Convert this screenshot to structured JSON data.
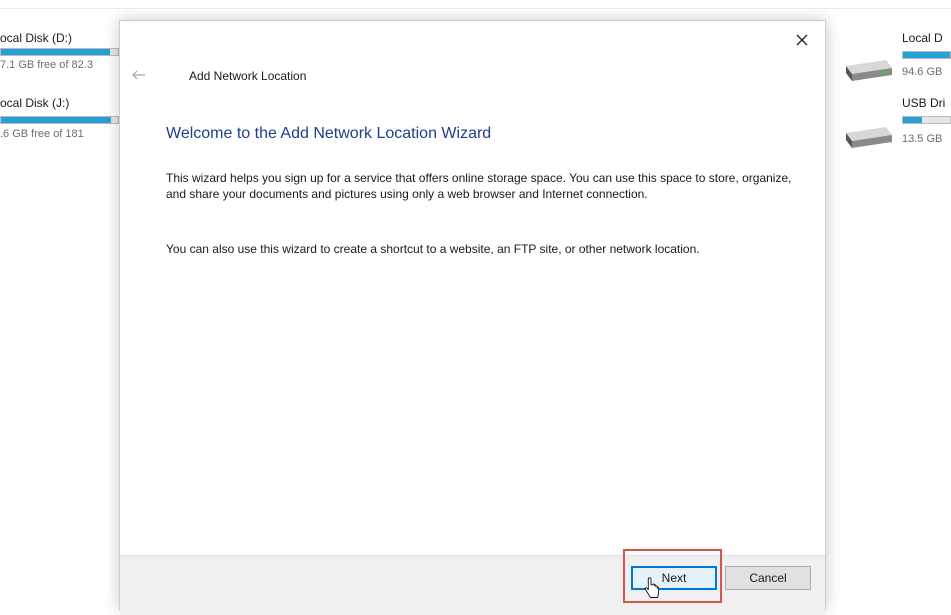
{
  "background": {
    "left_drives": [
      {
        "label": "ocal Disk (D:)",
        "free": "7.1 GB free of 82.3",
        "used_fraction": 0.93
      },
      {
        "label": "ocal Disk (J:)",
        "free": ".6 GB free of 181",
        "used_fraction": 0.94
      }
    ],
    "right_drives": [
      {
        "label": "Local D",
        "free": "94.6 GB",
        "used_fraction": 0.8
      },
      {
        "label": "USB Dri",
        "free": "13.5 GB",
        "used_fraction": 0.4
      }
    ]
  },
  "dialog": {
    "title": "Add Network Location",
    "heading": "Welcome to the Add Network Location Wizard",
    "paragraph1": "This wizard helps you sign up for a service that offers online storage space.  You can use this space to store, organize, and share your documents and pictures using only a web browser and Internet connection.",
    "paragraph2": "You can also use this wizard to create a shortcut to a website, an FTP site, or other network location.",
    "buttons": {
      "next": "Next",
      "cancel": "Cancel"
    }
  },
  "colors": {
    "heading": "#1e3f8c",
    "progress_fill": "#26a0da",
    "highlight": "#d9534f",
    "focus_border": "#0078d7"
  },
  "icons": [
    "close-icon",
    "back-arrow-icon",
    "hard-drive-icon",
    "usb-drive-icon",
    "mouse-cursor-icon"
  ]
}
